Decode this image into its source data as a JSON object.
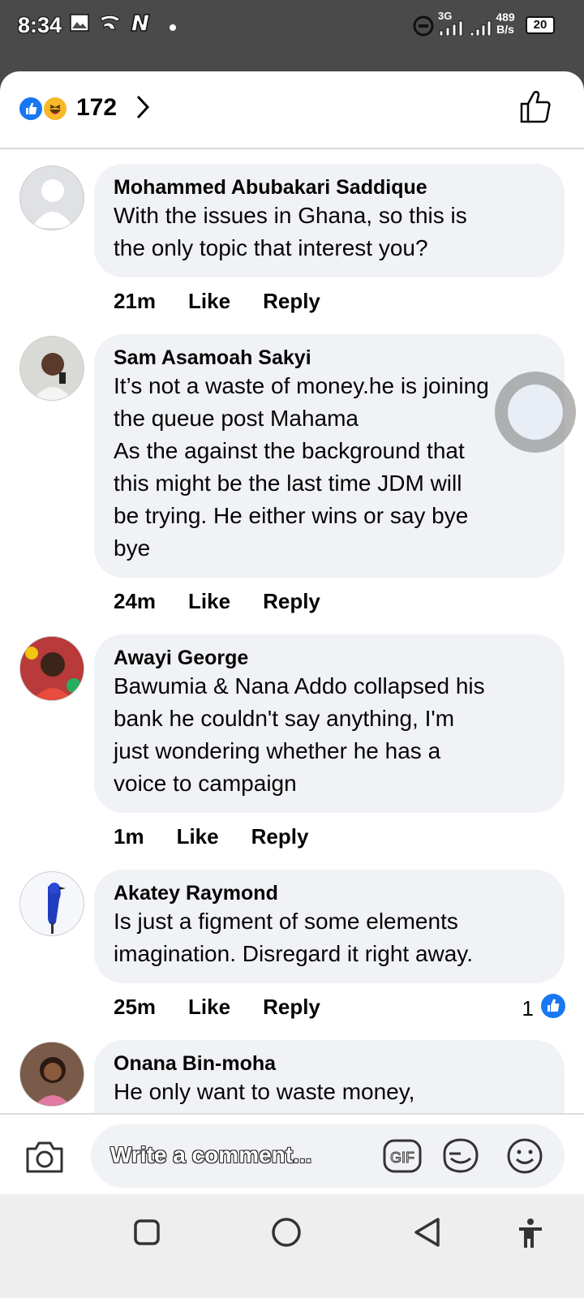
{
  "status_bar": {
    "time": "8:34",
    "network": "3G",
    "speed_value": "489",
    "speed_unit": "B/s",
    "battery": "20"
  },
  "reactions": {
    "count": "172"
  },
  "comments": [
    {
      "author": "Mohammed Abubakari Saddique",
      "text": "With the issues in Ghana, so this is\nthe only topic that interest you?",
      "time": "21m",
      "like_label": "Like",
      "reply_label": "Reply"
    },
    {
      "author": "Sam Asamoah Sakyi",
      "text": "It’s not a waste of money.he is joining\nthe queue post Mahama\nAs the against the background that\nthis might be the last time JDM will\nbe trying. He either wins or say bye\nbye",
      "time": "24m",
      "like_label": "Like",
      "reply_label": "Reply"
    },
    {
      "author": "Awayi George",
      "text": "Bawumia & Nana Addo collapsed his\nbank he couldn't say anything, I'm\njust wondering whether he has a\nvoice to campaign",
      "time": "1m",
      "like_label": "Like",
      "reply_label": "Reply"
    },
    {
      "author": "Akatey Raymond",
      "text": "Is just a figment of some elements\nimagination. Disregard it right away.",
      "time": "25m",
      "like_label": "Like",
      "reply_label": "Reply",
      "reaction_count": "1"
    },
    {
      "author": "Onana Bin-moha",
      "text": "He only want to waste money,"
    }
  ],
  "composer": {
    "placeholder": "Write a comment...",
    "gif_label": "GIF"
  },
  "colors": {
    "facebook_blue": "#1877f2",
    "bubble_bg": "#f0f2f5",
    "status_bar_bg": "#4a4a4a"
  }
}
